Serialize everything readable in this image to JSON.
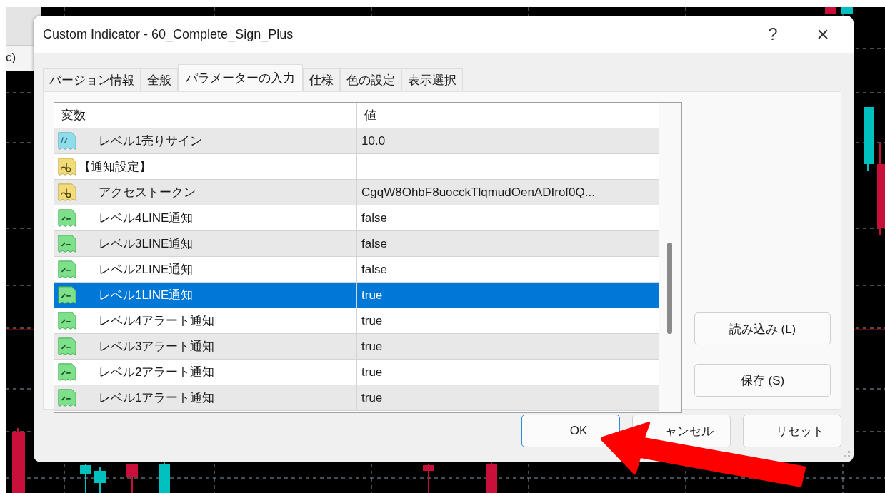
{
  "background_window": {
    "label": "c)"
  },
  "window": {
    "title": "Custom Indicator - 60_Complete_Sign_Plus",
    "help": "?",
    "close": "×"
  },
  "tabs": [
    {
      "label": "バージョン情報",
      "selected": false
    },
    {
      "label": "全般",
      "selected": false
    },
    {
      "label": "パラメーターの入力",
      "selected": true
    },
    {
      "label": "仕様",
      "selected": false
    },
    {
      "label": "色の設定",
      "selected": false
    },
    {
      "label": "表示選択",
      "selected": false
    }
  ],
  "table": {
    "columns": [
      "変数",
      "値"
    ],
    "rows": [
      {
        "kind": "double",
        "section": false,
        "name": "レベル1売りサイン",
        "value": "10.0",
        "selected": false
      },
      {
        "kind": "string",
        "section": true,
        "name": "【通知設定】",
        "selected": false
      },
      {
        "kind": "string",
        "section": false,
        "name": "アクセストークン",
        "value": "CgqW8OhbF8uocckTlqmudOenADIrof0Q...",
        "selected": false
      },
      {
        "kind": "bool",
        "section": false,
        "name": "レベル4LINE通知",
        "value": "false",
        "selected": false
      },
      {
        "kind": "bool",
        "section": false,
        "name": "レベル3LINE通知",
        "value": "false",
        "selected": false
      },
      {
        "kind": "bool",
        "section": false,
        "name": "レベル2LINE通知",
        "value": "false",
        "selected": false
      },
      {
        "kind": "bool",
        "section": false,
        "name": "レベル1LINE通知",
        "value": "true",
        "selected": true
      },
      {
        "kind": "bool",
        "section": false,
        "name": "レベル4アラート通知",
        "value": "true",
        "selected": false
      },
      {
        "kind": "bool",
        "section": false,
        "name": "レベル3アラート通知",
        "value": "true",
        "selected": false
      },
      {
        "kind": "bool",
        "section": false,
        "name": "レベル2アラート通知",
        "value": "true",
        "selected": false
      },
      {
        "kind": "bool",
        "section": false,
        "name": "レベル1アラート通知",
        "value": "true",
        "selected": false
      }
    ]
  },
  "side_buttons": [
    "読み込み (L)",
    "保存 (S)"
  ],
  "buttons": [
    {
      "label": "OK",
      "default": true
    },
    {
      "label": "ャンセル",
      "default": false
    },
    {
      "label": "リセット",
      "default": false
    }
  ]
}
